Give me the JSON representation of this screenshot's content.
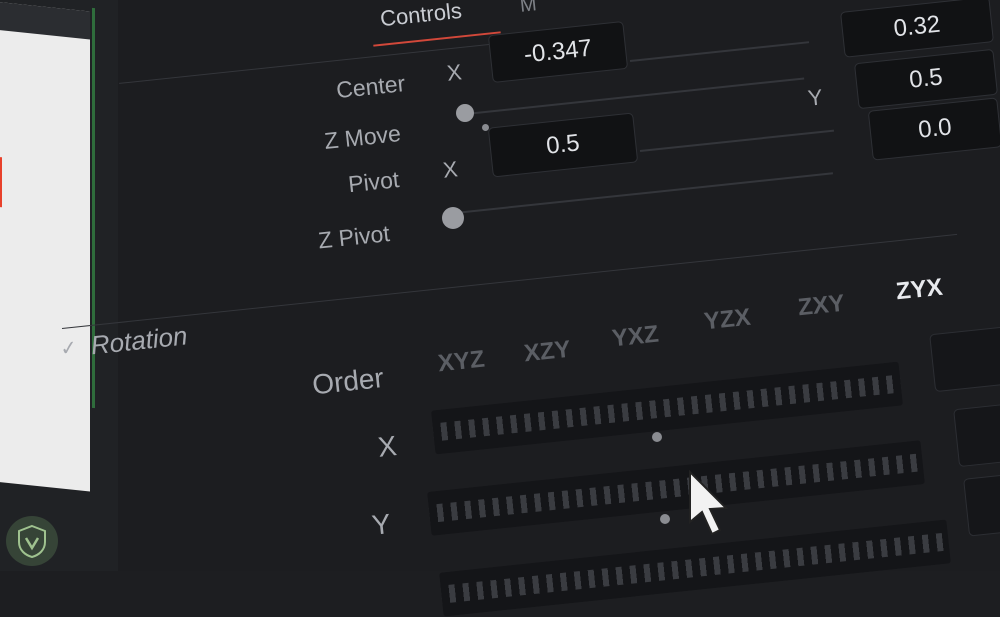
{
  "tabs": {
    "controls_label": "Controls",
    "media_label": "M"
  },
  "transform": {
    "center": {
      "label": "Center",
      "x_axis": "X",
      "x_value": "-0.347",
      "y_axis": "Y",
      "y_value": "0.5"
    },
    "z_move": {
      "label": "Z Move"
    },
    "pivot": {
      "label": "Pivot",
      "x_axis": "X",
      "x_value": "0.5"
    },
    "z_pivot": {
      "label": "Z Pivot"
    },
    "right_values": [
      "0.32",
      "0.5",
      "0.0"
    ]
  },
  "rotation": {
    "section_title": "Rotation",
    "order_label": "Order",
    "order_options": [
      "XYZ",
      "XZY",
      "YXZ",
      "YZX",
      "ZXY",
      "ZYX"
    ],
    "selected_order": "ZYX",
    "x_label": "X",
    "y_label": "Y"
  },
  "colors": {
    "accent": "#d2483a",
    "selected": "#e8eaee",
    "unselected": "#5b5e64"
  }
}
